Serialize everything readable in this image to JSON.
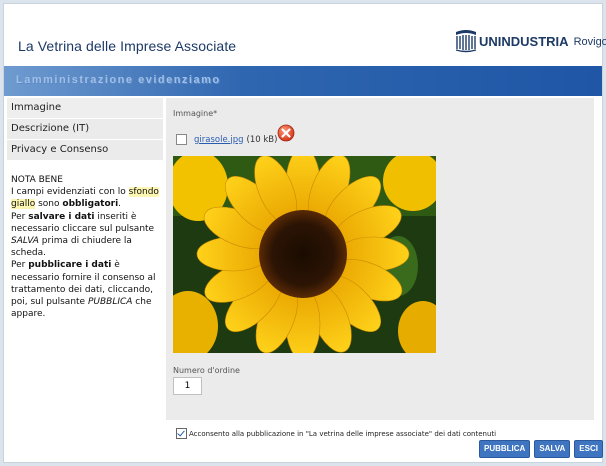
{
  "header": {
    "title": "La Vetrina delle Imprese Associate",
    "logo_name": "UNINDUSTRIA",
    "logo_sub": "Rovigo"
  },
  "banner": {
    "text": "Lamministrazione evidenziamo"
  },
  "sidebar": {
    "items": [
      {
        "label": "Immagine"
      },
      {
        "label": "Descrizione (IT)"
      },
      {
        "label": "Privacy e Consenso"
      }
    ]
  },
  "note": {
    "heading": "NOTA BENE",
    "line1_a": "I campi evidenziati con lo ",
    "line1_hl": "sfondo giallo",
    "line1_b": " sono ",
    "line1_strong": "obbligatori",
    "line1_c": ".",
    "line2_a": "Per ",
    "line2_strong": "salvare i dati",
    "line2_b": " inseriti è necessario cliccare sul pulsante ",
    "line2_em": "SALVA",
    "line2_c": " prima di chiudere la scheda.",
    "line3_a": "Per ",
    "line3_strong": "pubblicare i dati",
    "line3_b": " è necessario fornire il consenso al trattamento dei dati, cliccando, poi, sul pulsante ",
    "line3_em": "PUBBLICA",
    "line3_c": " che appare."
  },
  "form": {
    "image_label": "Immagine*",
    "file_name": "girasole.jpg",
    "file_size": "(10 kB)",
    "order_label": "Numero d'ordine",
    "order_value": "1"
  },
  "consent": {
    "text": "Acconsento alla pubblicazione in \"La vetrina delle imprese associate\" dei dati contenuti",
    "checked": true
  },
  "actions": {
    "publish": "PUBBLICA",
    "save": "SALVA",
    "exit": "ESCI"
  },
  "colors": {
    "banner": "#2f66b0",
    "button": "#3e74c0",
    "title": "#1d3a66",
    "highlight": "#fdf6b0"
  }
}
